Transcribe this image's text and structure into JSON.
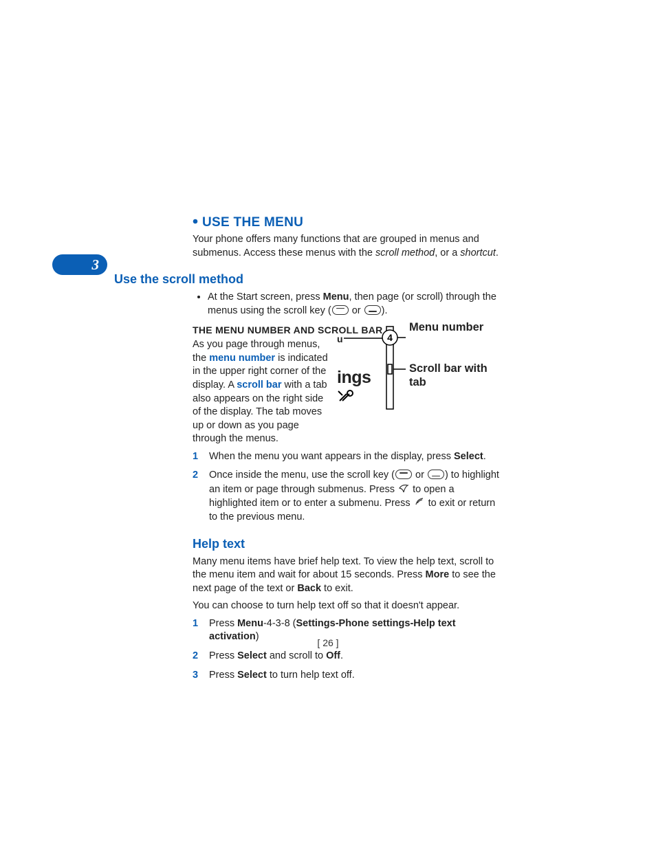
{
  "section_number": "3",
  "title": "USE THE MENU",
  "intro_a": "Your phone offers many functions that are grouped in menus and submenus. Access these menus with the ",
  "intro_scroll_method": "scroll method",
  "intro_mid": ", or a ",
  "intro_shortcut": "shortcut",
  "intro_end": ".",
  "sub1": "Use the scroll method",
  "scroll_bullet_a": "At the Start screen, press ",
  "scroll_bullet_menu": "Menu",
  "scroll_bullet_b": ", then page (or scroll) through the menus using the scroll key (",
  "scroll_bullet_or": " or ",
  "scroll_bullet_c": ").",
  "h3": "THE MENU NUMBER AND SCROLL BAR",
  "para_a": "As you page through menus, the ",
  "term_menu_number": "menu number",
  "para_b": " is indicated in the upper right corner of the display. A ",
  "term_scroll_bar": "scroll bar",
  "para_c": " with a tab also appears on the right side of the display. The tab moves up or down as you page through the menus.",
  "step1_a": "When the menu you want appears in the display, press ",
  "step1_select": "Select",
  "step1_end": ".",
  "step2_a": "Once inside the menu, use the scroll key (",
  "step2_or": " or ",
  "step2_b": ") to highlight an item or page through submenus. Press ",
  "step2_c": " to open a highlighted item or to enter a submenu. Press ",
  "step2_d": " to exit or return to the previous menu.",
  "sub2": "Help text",
  "help_p1_a": "Many menu items have brief help text. To view the help text, scroll to the menu item and wait for about 15 seconds. Press ",
  "help_more": "More",
  "help_p1_b": " to see the next page of the text or ",
  "help_back": "Back",
  "help_p1_c": " to exit.",
  "help_p2": "You can choose to turn help text off so that it doesn't appear.",
  "hstep1_a": "Press ",
  "hstep1_menu": "Menu",
  "hstep1_b": "-4-3-8 (",
  "hstep1_path": "Settings-Phone settings-Help text activation",
  "hstep1_c": ")",
  "hstep2_a": "Press ",
  "hstep2_select": "Select",
  "hstep2_b": " and scroll to ",
  "hstep2_off": "Off",
  "hstep2_c": ".",
  "hstep3_a": "Press ",
  "hstep3_select": "Select",
  "hstep3_b": " to turn help text off.",
  "fig": {
    "u": "u",
    "ings": "ings",
    "menu_number_label": "Menu number",
    "scrollbar_label": "Scroll bar with tab",
    "menu_number_value": "4"
  },
  "page_number": "[ 26 ]",
  "nums": {
    "one": "1",
    "two": "2",
    "three": "3"
  }
}
